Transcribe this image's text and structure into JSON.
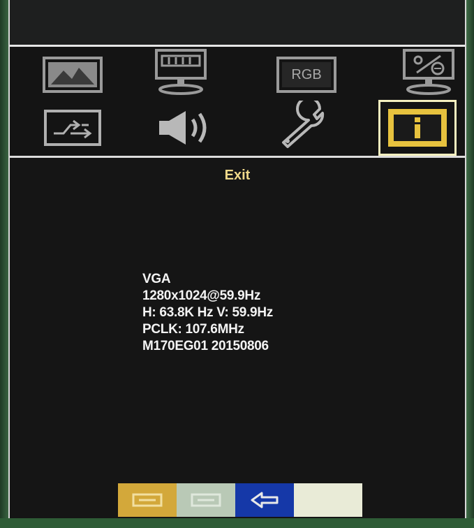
{
  "osd": {
    "title": "Exit",
    "menu_icons": [
      {
        "name": "picture-icon",
        "label": ""
      },
      {
        "name": "display-adjust-icon",
        "label": ""
      },
      {
        "name": "rgb-color-icon",
        "label": "RGB"
      },
      {
        "name": "monitor-settings-icon",
        "label": ""
      },
      {
        "name": "input-source-icon",
        "label": ""
      },
      {
        "name": "audio-speaker-icon",
        "label": ""
      },
      {
        "name": "wrench-tools-icon",
        "label": ""
      },
      {
        "name": "info-icon",
        "label": "i",
        "selected": true
      }
    ],
    "info": {
      "signal": "VGA",
      "resolution": "1280x1024@59.9Hz",
      "frequency": "H: 63.8K Hz  V: 59.9Hz",
      "pclk": "PCLK: 107.6MHz",
      "model": "M170EG01 20150806"
    },
    "buttons": [
      {
        "name": "menu-button",
        "color": "#d3a83a"
      },
      {
        "name": "select-button",
        "color": "#b9c9b6"
      },
      {
        "name": "back-button",
        "color": "#1538a8"
      },
      {
        "name": "blank-button",
        "color": "#e9ebd7"
      }
    ]
  }
}
